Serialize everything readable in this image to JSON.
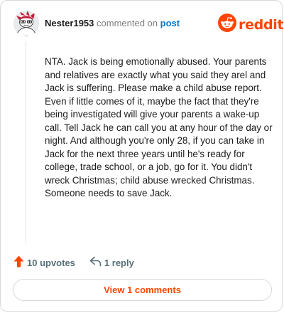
{
  "comment": {
    "username": "Nester1953",
    "commented_text": "commented on",
    "post_link_label": "post",
    "body": "NTA. Jack is being emotionally abused. Your parents and relatives are exactly what you said they arel and Jack is suffering. Please make a child abuse report. Even if little comes of it, maybe the fact that they're being investigated will give your parents a wake-up call. Tell Jack he can call you at any hour of the day or night. And although you're only 28, if you can take in Jack for the next three years until he's ready for college, trade school, or a job, go for it. You didn't wreck Christmas; child abuse wrecked Christmas. Someone needs to save Jack."
  },
  "brand": {
    "wordmark": "reddit",
    "color": "#ff4500"
  },
  "actions": {
    "upvotes_label": "10 upvotes",
    "reply_label": "1 reply"
  },
  "footer": {
    "view_comments_label": "View 1 comments"
  },
  "icons": {
    "avatar": "snoo-avatar-icon",
    "logo": "reddit-snoo-icon",
    "upvote": "upvote-arrow-icon",
    "reply": "reply-arrow-icon"
  },
  "colors": {
    "accent": "#ff4500",
    "link": "#0079d3",
    "muted": "#576f76"
  }
}
